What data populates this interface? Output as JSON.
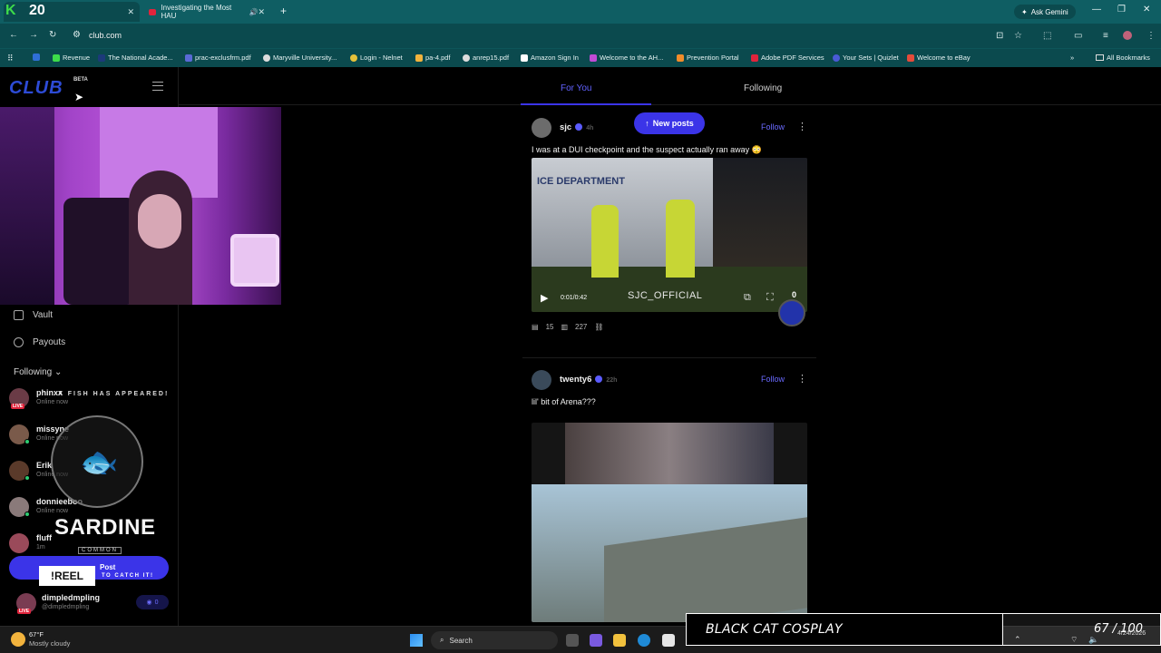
{
  "browser": {
    "tabs": [
      {
        "label": "",
        "active": true
      },
      {
        "label": "Investigating the Most HAU"
      }
    ],
    "ask_gemini": "Ask Gemini",
    "url": "club.com",
    "bookmarks": [
      "Revenue",
      "The National Acade...",
      "prac-exclusfrm.pdf",
      "Maryville University...",
      "Login - Nelnet",
      "pa-4.pdf",
      "anrep15.pdf",
      "Amazon Sign In",
      "Welcome to the AH...",
      "Prevention Portal",
      "Adobe PDF Services",
      "Your Sets | Quizlet",
      "Welcome to eBay"
    ],
    "all_bookmarks": "All Bookmarks"
  },
  "overlay": {
    "k_logo": "K",
    "k_count": "20"
  },
  "site": {
    "logo": "CLUB",
    "beta": "BETA"
  },
  "sidebar": {
    "items": [
      {
        "label": "Vault"
      },
      {
        "label": "Payouts"
      }
    ],
    "following_header": "Following",
    "users": [
      {
        "name": "phinxx",
        "status": "Online now",
        "live": "LIVE"
      },
      {
        "name": "missyne",
        "status": "Online now"
      },
      {
        "name": "Erik",
        "status": "Online now"
      },
      {
        "name": "donnieeboo",
        "status": "Online now"
      },
      {
        "name": "fluff",
        "status": "1m"
      }
    ],
    "post_button": "Post",
    "me": {
      "name": "dimpledmpling",
      "handle": "@dimpledmpling",
      "live": "LIVE",
      "points": "0"
    }
  },
  "fish_game": {
    "appeared": "A FISH HAS APPEARED!",
    "name": "SARDINE",
    "rarity": "COMMON",
    "command": "!REEL",
    "catch": "TO CATCH IT!"
  },
  "feed": {
    "tabs": [
      {
        "label": "For You"
      },
      {
        "label": "Following"
      }
    ],
    "new_posts": "New posts",
    "posts": [
      {
        "author": "sjc",
        "time": "4h",
        "follow": "Follow",
        "text": "I was at a DUI checkpoint and the suspect actually ran away 😳",
        "video_text": "ICE DEPARTMENT",
        "video_time": "0:01/0:42",
        "watermark": "SJC_OFFICIAL",
        "badge_count": "0",
        "comments": "15",
        "views": "227"
      },
      {
        "author": "twenty6",
        "time": "22h",
        "follow": "Follow",
        "text": "lil' bit of Arena???"
      }
    ]
  },
  "taskbar": {
    "temp": "67°F",
    "weather": "Mostly cloudy",
    "search": "Search",
    "time": "",
    "date": "4/24/2026"
  },
  "stream_overlay": {
    "banner": "BLACK CAT COSPLAY",
    "score": "67 / 100"
  }
}
